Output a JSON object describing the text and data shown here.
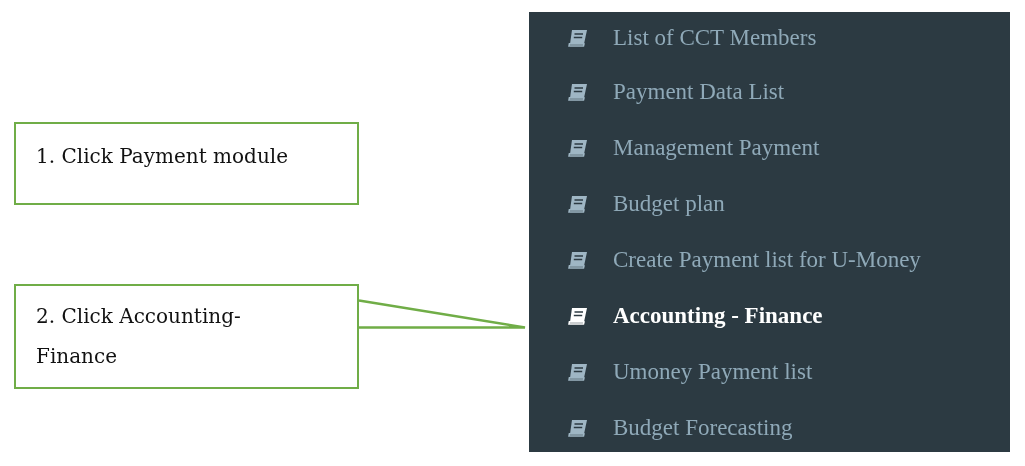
{
  "callouts": [
    {
      "kind": "plain",
      "text": "1. Click Payment module"
    },
    {
      "kind": "pointer",
      "text": "2. Click Accounting-Finance"
    }
  ],
  "menu": {
    "items": [
      {
        "label": "List of CCT Members",
        "selected": false
      },
      {
        "label": "Payment Data List",
        "selected": false
      },
      {
        "label": "Management Payment",
        "selected": false
      },
      {
        "label": "Budget plan",
        "selected": false
      },
      {
        "label": "Create Payment list for U-Money",
        "selected": false
      },
      {
        "label": "Accounting - Finance",
        "selected": true
      },
      {
        "label": "Umoney Payment list",
        "selected": false
      },
      {
        "label": "Budget Forecasting",
        "selected": false
      }
    ]
  }
}
